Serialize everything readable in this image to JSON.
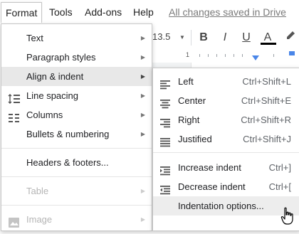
{
  "menubar": {
    "items": [
      {
        "label": "Format"
      },
      {
        "label": "Tools"
      },
      {
        "label": "Add-ons"
      },
      {
        "label": "Help"
      }
    ],
    "save_status": "All changes saved in Drive"
  },
  "toolbar": {
    "font_size": "13.5",
    "bold": "B",
    "italic": "I",
    "underline": "U",
    "text_color": "A"
  },
  "ruler": {
    "label": "1"
  },
  "format_menu": {
    "items": [
      {
        "label": "Text",
        "has_submenu": true
      },
      {
        "label": "Paragraph styles",
        "has_submenu": true
      },
      {
        "label": "Align & indent",
        "has_submenu": true,
        "highlighted": true
      },
      {
        "label": "Line spacing",
        "icon": "line-spacing-icon",
        "has_submenu": true
      },
      {
        "label": "Columns",
        "icon": "columns-icon",
        "has_submenu": true
      },
      {
        "label": "Bullets & numbering",
        "has_submenu": true
      },
      {
        "label": "Headers & footers..."
      },
      {
        "label": "Table",
        "has_submenu": true,
        "disabled": true
      },
      {
        "label": "Image",
        "icon": "image-icon",
        "has_submenu": true,
        "disabled": true
      }
    ]
  },
  "align_menu": {
    "items": [
      {
        "label": "Left",
        "shortcut": "Ctrl+Shift+L",
        "icon": "align-left-icon"
      },
      {
        "label": "Center",
        "shortcut": "Ctrl+Shift+E",
        "icon": "align-center-icon"
      },
      {
        "label": "Right",
        "shortcut": "Ctrl+Shift+R",
        "icon": "align-right-icon"
      },
      {
        "label": "Justified",
        "shortcut": "Ctrl+Shift+J",
        "icon": "align-justify-icon"
      },
      {
        "label": "Increase indent",
        "shortcut": "Ctrl+]",
        "icon": "indent-increase-icon"
      },
      {
        "label": "Decrease indent",
        "shortcut": "Ctrl+[",
        "icon": "indent-decrease-icon"
      },
      {
        "label": "Indentation options...",
        "highlighted": true
      }
    ]
  },
  "colors": {
    "highlight": "#e8e8e8",
    "ruler_marker": "#4a86e8",
    "disabled_text": "#b5b5b5"
  }
}
